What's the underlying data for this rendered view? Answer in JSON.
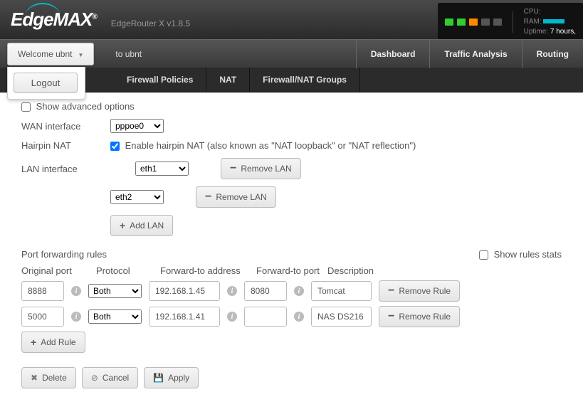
{
  "header": {
    "logo": "EdgeMAX",
    "subtitle": "EdgeRouter X v1.8.5",
    "stats": {
      "cpu_label": "CPU:",
      "ram_label": "RAM:",
      "uptime_label": "Uptime:",
      "uptime_value": "7 hours,"
    }
  },
  "navbar": {
    "welcome": "Welcome ubnt",
    "logout": "Logout",
    "link": "to ubnt",
    "tabs": [
      "Dashboard",
      "Traffic Analysis",
      "Routing"
    ]
  },
  "subtabs": [
    "Firewall Policies",
    "NAT",
    "Firewall/NAT Groups"
  ],
  "form": {
    "show_advanced": "Show advanced options",
    "wan_label": "WAN interface",
    "wan_value": "pppoe0",
    "hairpin_label": "Hairpin NAT",
    "hairpin_text": "Enable hairpin NAT (also known as \"NAT loopback\" or \"NAT reflection\")",
    "lan_label": "LAN interface",
    "lan_values": [
      "eth1",
      "eth2"
    ],
    "remove_lan": "Remove LAN",
    "add_lan": "Add LAN"
  },
  "rules": {
    "title": "Port forwarding rules",
    "show_stats": "Show rules stats",
    "headers": {
      "oport": "Original port",
      "proto": "Protocol",
      "addr": "Forward-to address",
      "fport": "Forward-to port",
      "desc": "Description"
    },
    "rows": [
      {
        "oport": "8888",
        "proto": "Both",
        "addr": "192.168.1.45",
        "fport": "8080",
        "desc": "Tomcat"
      },
      {
        "oport": "5000",
        "proto": "Both",
        "addr": "192.168.1.41",
        "fport": "",
        "desc": "NAS DS216"
      }
    ],
    "remove_rule": "Remove Rule",
    "add_rule": "Add Rule"
  },
  "actions": {
    "delete": "Delete",
    "cancel": "Cancel",
    "apply": "Apply"
  }
}
